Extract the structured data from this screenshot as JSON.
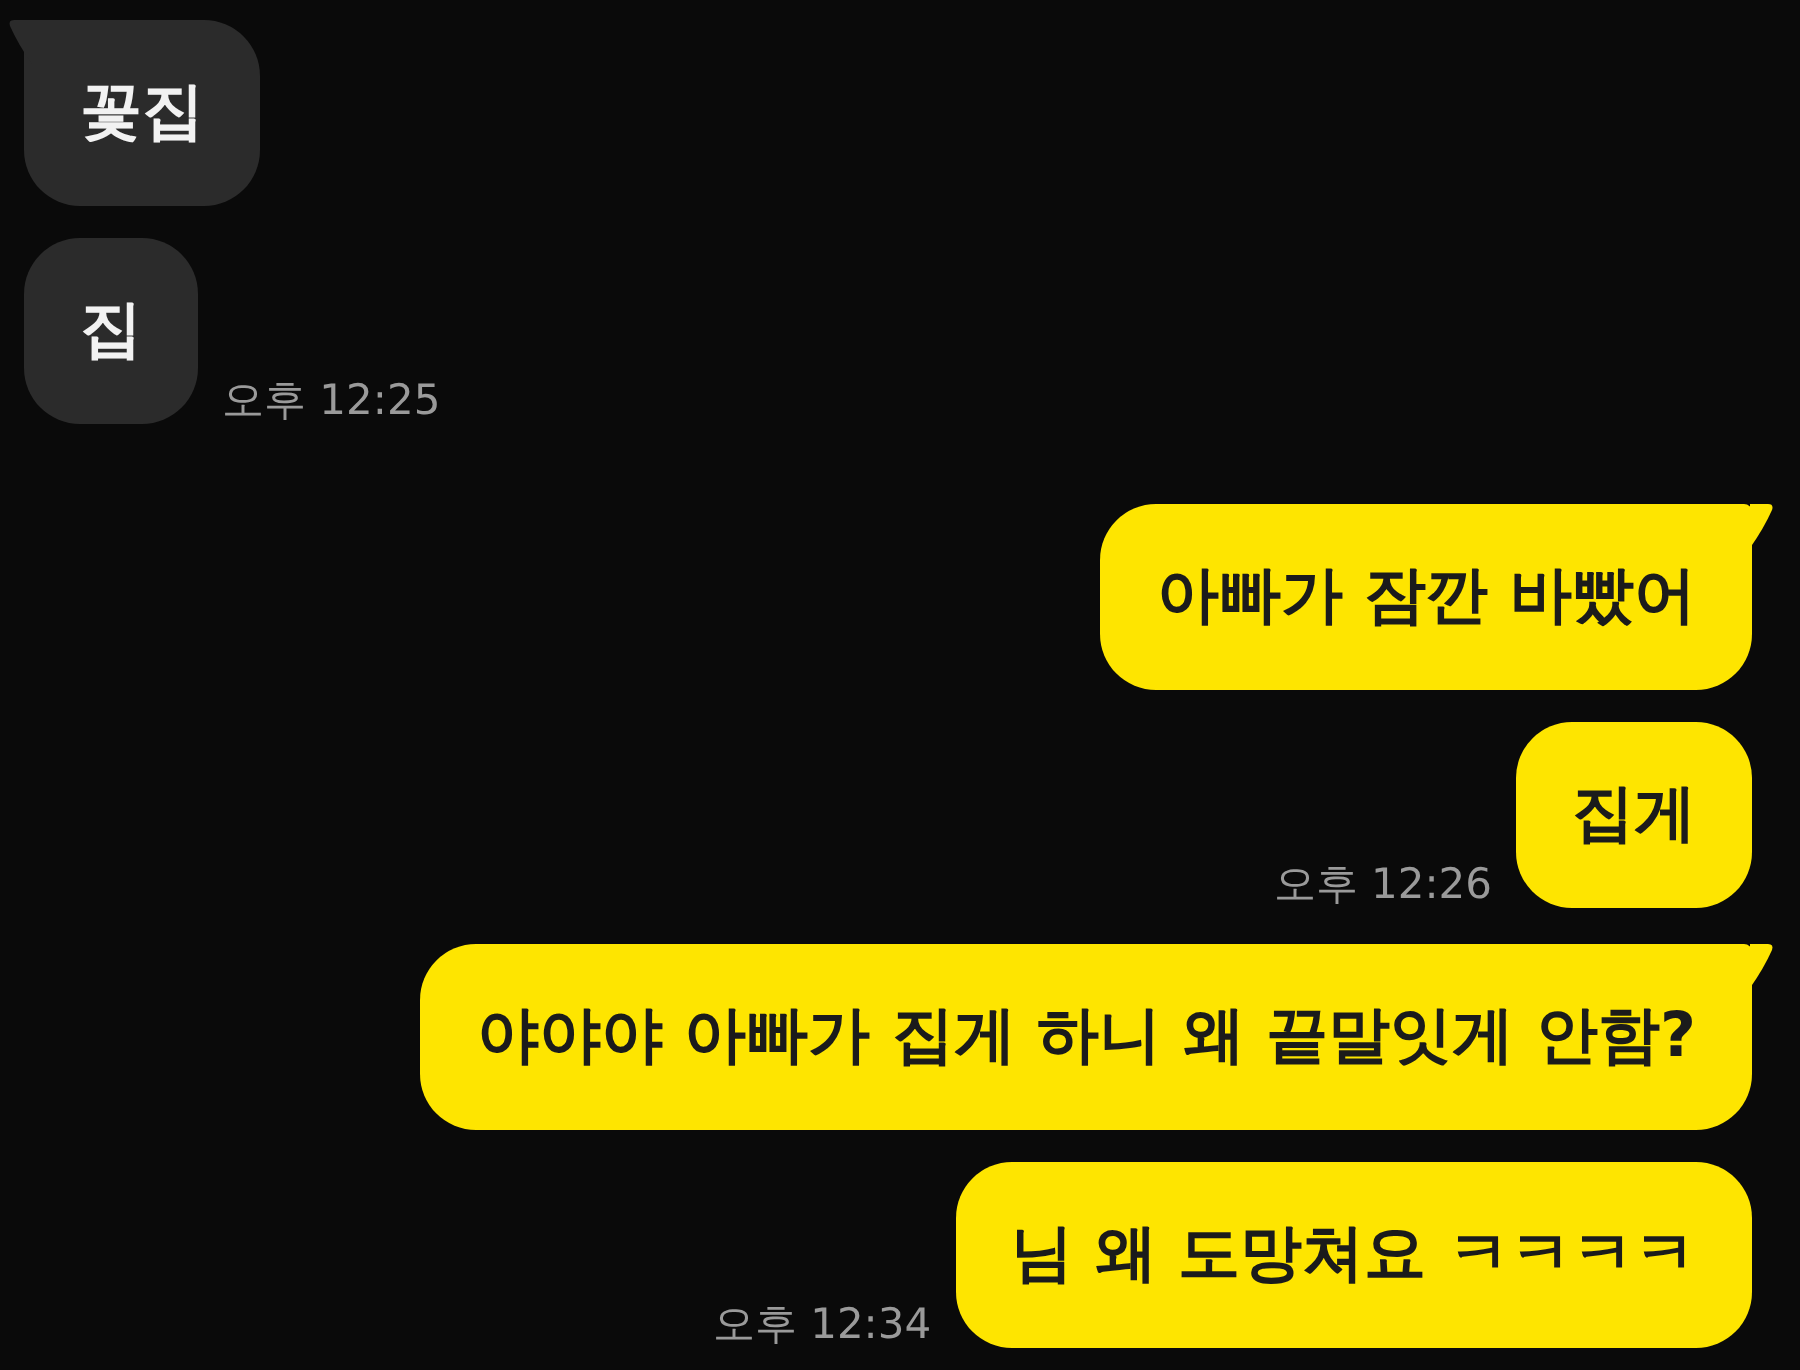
{
  "chat": {
    "groups": [
      {
        "kind": "received",
        "messages": [
          "꽃집",
          "집"
        ],
        "time": "오후 12:25"
      },
      {
        "kind": "sent",
        "messages": [
          "아빠가 잠깐 바빴어",
          "집게"
        ],
        "time": "오후 12:26"
      },
      {
        "kind": "sent",
        "messages": [
          "야야야 아빠가 집게 하니 왜 끝말잇게 안함?",
          "님 왜 도망쳐요 ㅋㅋㅋㅋ"
        ],
        "time": "오후 12:34"
      }
    ]
  }
}
